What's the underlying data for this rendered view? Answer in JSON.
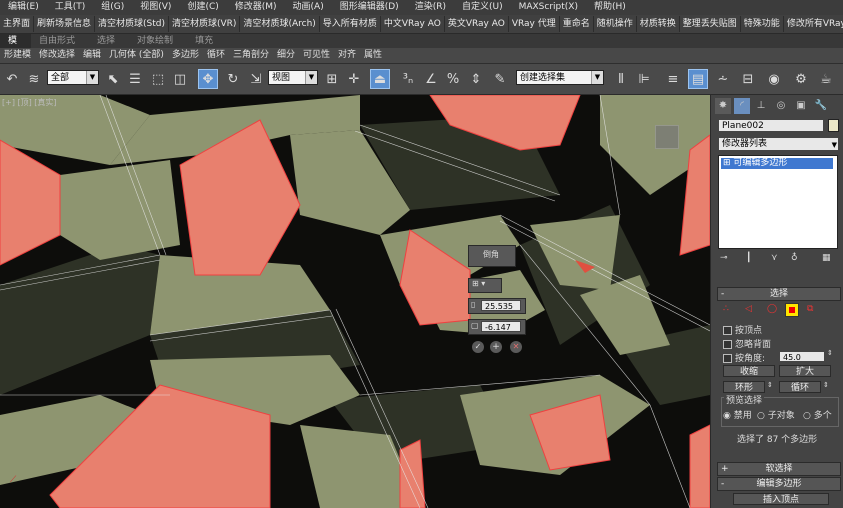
{
  "menubar": {
    "items": [
      "编辑(E)",
      "工具(T)",
      "组(G)",
      "视图(V)",
      "创建(C)",
      "修改器(M)",
      "动画(A)",
      "图形编辑器(D)",
      "渲染(R)",
      "自定义(U)",
      "MAXScript(X)",
      "帮助(H)"
    ]
  },
  "script_bar": {
    "items": [
      "主界面",
      "刷新场景信息",
      "清空材质球(Std)",
      "清空材质球(VR)",
      "清空材质球(Arch)",
      "导入所有材质",
      "中文VRay AO",
      "英文VRay AO",
      "VRay 代理",
      "重命名",
      "随机操作",
      "材质转换",
      "整理丢失贴图",
      "特殊功能",
      "修改所有VRayMtl"
    ]
  },
  "ribbon_tabs": {
    "items": [
      "模",
      "自由形式",
      "选择",
      "对象绘制",
      "填充"
    ],
    "active_index": 0
  },
  "sub_ribbon": {
    "items": [
      "形建模",
      "修改选择",
      "编辑",
      "几何体 (全部)",
      "多边形",
      "循环",
      "三角剖分",
      "细分",
      "可见性",
      "对齐",
      "属性"
    ]
  },
  "toolbar": {
    "selection_filter": "全部",
    "reference_coord": "视图",
    "named_selection_set": "创建选择集"
  },
  "viewport": {
    "label": "[+] [顶] [真实]",
    "caddy": {
      "title": "倒角",
      "height_value": "25.535",
      "outline_value": "-6.147"
    },
    "colors": {
      "salmon": "#e8806e",
      "olive": "#8e9570",
      "dark": "#2e3226",
      "black": "#0d0d0b"
    }
  },
  "command_panel": {
    "object_name": "Plane002",
    "object_color": "#ece8c8",
    "modifier_list": "修改器列表",
    "stack_item": "可编辑多边形",
    "selection": {
      "header": "选择",
      "by_vertex": "按顶点",
      "ignore_backfacing": "忽略背面",
      "by_angle": "按角度:",
      "angle_value": "45.0",
      "shrink": "收缩",
      "grow": "扩大",
      "ring": "环形",
      "loop": "循环",
      "preview_label": "预览选择",
      "preview_options": [
        "禁用",
        "子对象",
        "多个"
      ],
      "status": "选择了 87 个多边形"
    },
    "soft_selection_header": "软选择",
    "edit_polygons_header": "编辑多边形",
    "insert_vertex": "插入顶点"
  }
}
